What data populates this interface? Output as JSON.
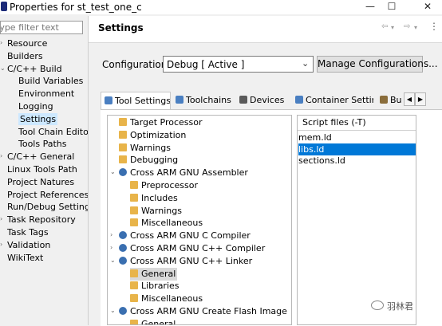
{
  "window": {
    "title": "Properties for st_test_one_c",
    "minimize": "—",
    "maximize": "☐",
    "close": "✕"
  },
  "filter": {
    "placeholder": "type filter text"
  },
  "nav": {
    "items": [
      {
        "label": "Resource",
        "arrow": "›",
        "level": 0
      },
      {
        "label": "Builders",
        "arrow": "",
        "level": 0
      },
      {
        "label": "C/C++ Build",
        "arrow": "⌄",
        "level": 0
      },
      {
        "label": "Build Variables",
        "arrow": "",
        "level": 1
      },
      {
        "label": "Environment",
        "arrow": "",
        "level": 1
      },
      {
        "label": "Logging",
        "arrow": "",
        "level": 1
      },
      {
        "label": "Settings",
        "arrow": "",
        "level": 1,
        "selected": true
      },
      {
        "label": "Tool Chain Editor",
        "arrow": "",
        "level": 1
      },
      {
        "label": "Tools Paths",
        "arrow": "",
        "level": 1
      },
      {
        "label": "C/C++ General",
        "arrow": "›",
        "level": 0
      },
      {
        "label": "Linux Tools Path",
        "arrow": "",
        "level": 0
      },
      {
        "label": "Project Natures",
        "arrow": "",
        "level": 0
      },
      {
        "label": "Project References",
        "arrow": "",
        "level": 0
      },
      {
        "label": "Run/Debug Settings",
        "arrow": "",
        "level": 0
      },
      {
        "label": "Task Repository",
        "arrow": "›",
        "level": 0
      },
      {
        "label": "Task Tags",
        "arrow": "",
        "level": 0
      },
      {
        "label": "Validation",
        "arrow": "›",
        "level": 0
      },
      {
        "label": "WikiText",
        "arrow": "",
        "level": 0
      }
    ]
  },
  "header": {
    "title": "Settings",
    "back_icon": "⇦",
    "back_dropdown": "▾",
    "forward_icon": "⇨",
    "forward_dropdown": "▾",
    "menu_icon": "⋮"
  },
  "configuration": {
    "label": "Configuration:",
    "value": "Debug  [ Active ]",
    "caret": "⌄",
    "manage_button": "Manage Configurations..."
  },
  "tabs": [
    {
      "label": "Tool Settings",
      "icon_color": "#4a7fc1",
      "active": true
    },
    {
      "label": "Toolchains",
      "icon_color": "#4a7fc1"
    },
    {
      "label": "Devices",
      "icon_color": "#5a5a5a"
    },
    {
      "label": "Container Settings",
      "icon_color": "#4a7fc1"
    },
    {
      "label": "Bu",
      "icon_color": "#8a6d3b"
    }
  ],
  "tab_scroll": {
    "left": "◀",
    "right": "▶"
  },
  "tree": {
    "items": [
      {
        "label": "Target Processor",
        "level": 0,
        "arrow": ""
      },
      {
        "label": "Optimization",
        "level": 0,
        "arrow": ""
      },
      {
        "label": "Warnings",
        "level": 0,
        "arrow": ""
      },
      {
        "label": "Debugging",
        "level": 0,
        "arrow": ""
      },
      {
        "label": "Cross ARM GNU Assembler",
        "level": 0,
        "arrow": "⌄",
        "tool": true
      },
      {
        "label": "Preprocessor",
        "level": 1,
        "arrow": ""
      },
      {
        "label": "Includes",
        "level": 1,
        "arrow": ""
      },
      {
        "label": "Warnings",
        "level": 1,
        "arrow": ""
      },
      {
        "label": "Miscellaneous",
        "level": 1,
        "arrow": ""
      },
      {
        "label": "Cross ARM GNU C Compiler",
        "level": 0,
        "arrow": "›",
        "tool": true
      },
      {
        "label": "Cross ARM GNU C++ Compiler",
        "level": 0,
        "arrow": "›",
        "tool": true
      },
      {
        "label": "Cross ARM GNU C++ Linker",
        "level": 0,
        "arrow": "⌄",
        "tool": true
      },
      {
        "label": "General",
        "level": 1,
        "arrow": "",
        "selected": true
      },
      {
        "label": "Libraries",
        "level": 1,
        "arrow": ""
      },
      {
        "label": "Miscellaneous",
        "level": 1,
        "arrow": ""
      },
      {
        "label": "Cross ARM GNU Create Flash Image",
        "level": 0,
        "arrow": "⌄",
        "tool": true
      },
      {
        "label": "General",
        "level": 1,
        "arrow": ""
      }
    ]
  },
  "script_files": {
    "header": "Script files (-T)",
    "items": [
      {
        "label": "mem.ld"
      },
      {
        "label": "libs.ld",
        "selected": true
      },
      {
        "label": "sections.ld"
      }
    ]
  },
  "watermark": {
    "text": "羽林君"
  },
  "colors": {
    "selection": "#0078d7",
    "nav_selection": "#cde8ff",
    "folder_icon": "#e8b44a",
    "tool_icon": "#3a6fb0"
  }
}
